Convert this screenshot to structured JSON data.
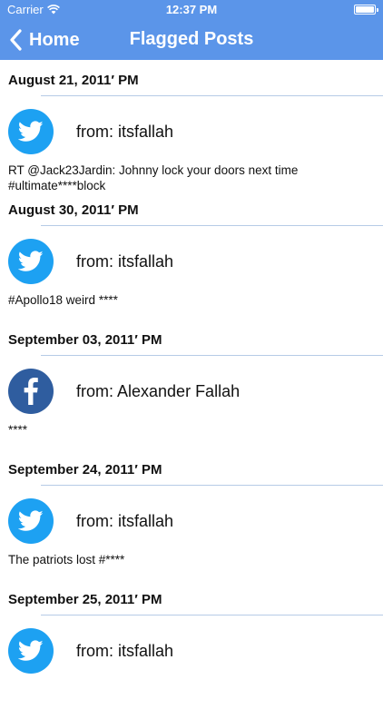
{
  "status_bar": {
    "carrier": "Carrier",
    "time": "12:37 PM"
  },
  "nav": {
    "back_label": "Home",
    "title": "Flagged Posts"
  },
  "colors": {
    "header": "#5b95e9",
    "twitter": "#1da1f2",
    "facebook": "#2f5d9f",
    "divider": "#b6cbe6"
  },
  "posts": [
    {
      "date": "August 21, 2011′ PM",
      "source_icon": "twitter-icon",
      "author": "from: itsfallah",
      "text": "RT @Jack23Jardin: Johnny lock your doors next time #ultimate****block"
    },
    {
      "date": "August 30, 2011′ PM",
      "source_icon": "twitter-icon",
      "author": "from: itsfallah",
      "text": "#Apollo18 weird ****"
    },
    {
      "date": "September 03, 2011′ PM",
      "source_icon": "facebook-icon",
      "author": "from: Alexander Fallah",
      "text": "****"
    },
    {
      "date": "September 24, 2011′ PM",
      "source_icon": "twitter-icon",
      "author": "from: itsfallah",
      "text": "The patriots lost #****"
    },
    {
      "date": "September 25, 2011′ PM",
      "source_icon": "twitter-icon",
      "author": "from: itsfallah",
      "text": ""
    }
  ]
}
